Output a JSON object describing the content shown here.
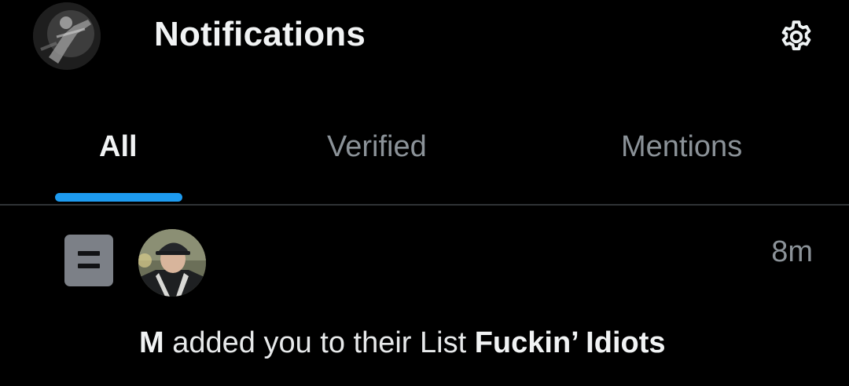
{
  "header": {
    "title": "Notifications",
    "profile_avatar": "profile-photo-guitarist",
    "settings_icon": "gear-icon"
  },
  "tabs": [
    {
      "label": "All",
      "active": true
    },
    {
      "label": "Verified",
      "active": false
    },
    {
      "label": "Mentions",
      "active": false
    }
  ],
  "notifications": [
    {
      "type_icon": "list-icon",
      "avatar": "user-photo-cap",
      "timestamp": "8m",
      "actor": "M",
      "action": "added you to their List",
      "list_name": "Fuckin’ Idiots"
    }
  ],
  "colors": {
    "background": "#000000",
    "accent": "#1d9bf0",
    "primary_text": "#e7e9ea",
    "secondary_text": "#8b9298",
    "divider": "#2f3336"
  }
}
